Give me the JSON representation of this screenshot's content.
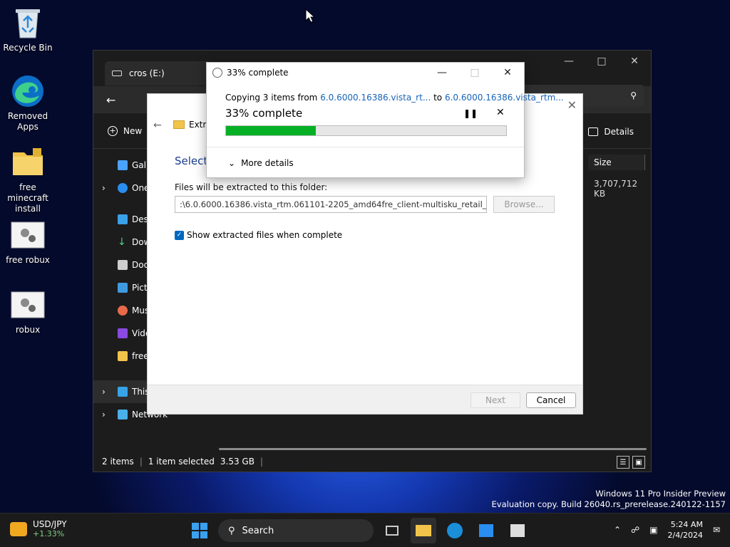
{
  "desktop": {
    "icons": [
      {
        "label": "Recycle Bin",
        "icon": "recycle-bin-icon"
      },
      {
        "label": "Removed Apps",
        "icon": "edge-icon"
      },
      {
        "label": "free minecraft install",
        "icon": "folder-icon"
      },
      {
        "label": "free robux",
        "icon": "settings-file-icon"
      },
      {
        "label": "robux",
        "icon": "settings-file-icon"
      }
    ]
  },
  "explorer": {
    "tab_title": "cros (E:)",
    "new_label": "New",
    "details_label": "Details",
    "sidebar": [
      "Gall",
      "One",
      "Desl",
      "Dow",
      "Doc",
      "Pict",
      "Mus",
      "Vide",
      "free",
      "This PC",
      "Network"
    ],
    "column_size": "Size",
    "size_value": "3,707,712 KB",
    "status": {
      "items": "2 items",
      "selected": "1 item selected",
      "size": "3.53 GB"
    }
  },
  "wizard": {
    "header": "Extra",
    "title": "Select",
    "folder_label": "Files will be extracted to this folder:",
    "path_value": ":\\6.0.6000.16386.vista_rtm.061101-2205_amd64fre_client-multisku_retail_en-us [+]",
    "browse_label": "Browse...",
    "checkbox_label": "Show extracted files when complete",
    "next_label": "Next",
    "cancel_label": "Cancel"
  },
  "copy": {
    "title": "33% complete",
    "line_prefix": "Copying 3 items from ",
    "source": "6.0.6000.16386.vista_rt...",
    "to": " to ",
    "dest": "6.0.6000.16386.vista_rtm...",
    "big": "33% complete",
    "progress": 0.32,
    "more_details": "More details"
  },
  "taskbar": {
    "widget_title": "USD/JPY",
    "widget_value": "+1.33%",
    "search_label": "Search",
    "time": "5:24 AM",
    "date": "2/4/2024"
  },
  "watermark": {
    "line1": "Windows 11 Pro Insider Preview",
    "line2": "Evaluation copy. Build 26040.rs_prerelease.240122-1157"
  }
}
